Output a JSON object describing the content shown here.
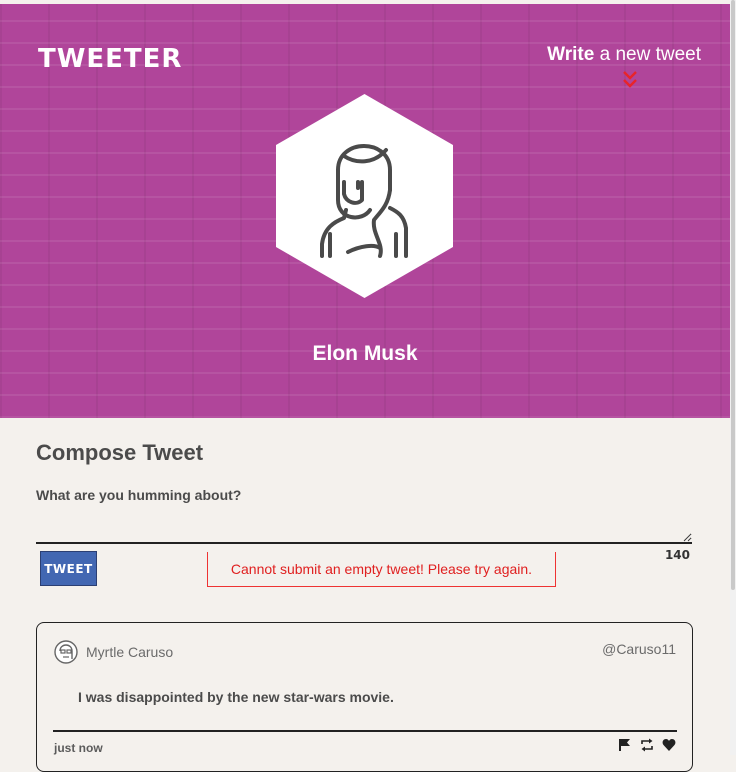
{
  "nav": {
    "logo": "TWEETER",
    "write_bold": "Write",
    "write_rest": " a new tweet"
  },
  "profile": {
    "name": "Elon Musk",
    "avatar_icon": "woman-avatar-icon"
  },
  "compose": {
    "title": "Compose Tweet",
    "label": "What are you humming about?",
    "textarea_value": "",
    "tweet_button": "TWEET",
    "error": "Cannot submit an empty tweet! Please try again.",
    "counter": "140"
  },
  "tweets": [
    {
      "author": "Myrtle Caruso",
      "handle": "@Caruso11",
      "text": "I was disappointed by the new star-wars movie.",
      "time": "just now",
      "actions": [
        "flag-icon",
        "retweet-icon",
        "heart-icon"
      ]
    }
  ],
  "colors": {
    "header_bg": "#b0459a",
    "page_bg": "#f4f1ed",
    "button_bg": "#4267b2",
    "error": "#e02020",
    "chevron": "#e8242a"
  }
}
